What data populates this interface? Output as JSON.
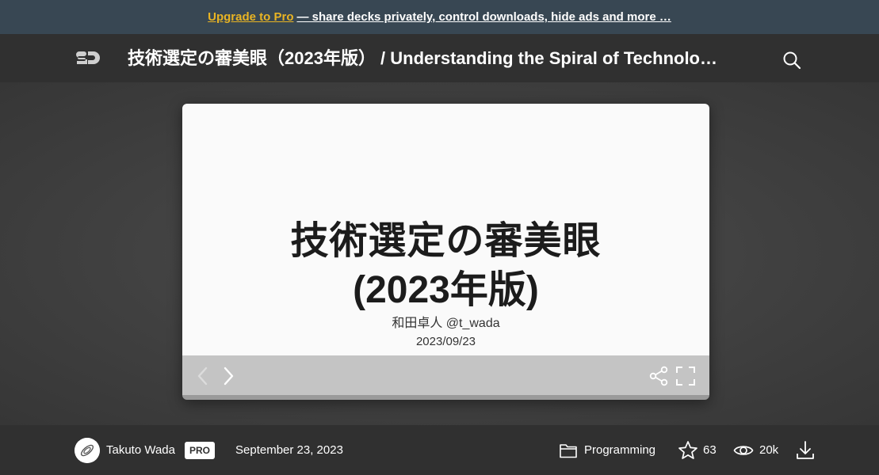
{
  "promo": {
    "link_text": "Upgrade to Pro",
    "message": "— share decks privately, control downloads, hide ads and more …",
    "link_color": "#e9b423"
  },
  "header": {
    "logo_icon": "speakerdeck-logo-icon",
    "title": "技術選定の審美眼（2023年版） / Understanding the Spiral of Technolo…",
    "search_icon": "search-icon"
  },
  "slide": {
    "title_line1": "技術選定の審美眼",
    "title_line2": "(2023年版)",
    "author": "和田卓人 @t_wada",
    "date": "2023/09/23"
  },
  "controls": {
    "prev_icon": "chevron-left-icon",
    "next_icon": "chevron-right-icon",
    "share_icon": "share-icon",
    "fullscreen_icon": "fullscreen-icon"
  },
  "footer": {
    "author_name": "Takuto Wada",
    "badge": "PRO",
    "published": "September 23, 2023",
    "category": "Programming",
    "stars": "63",
    "views": "20k",
    "download_icon": "download-icon"
  }
}
